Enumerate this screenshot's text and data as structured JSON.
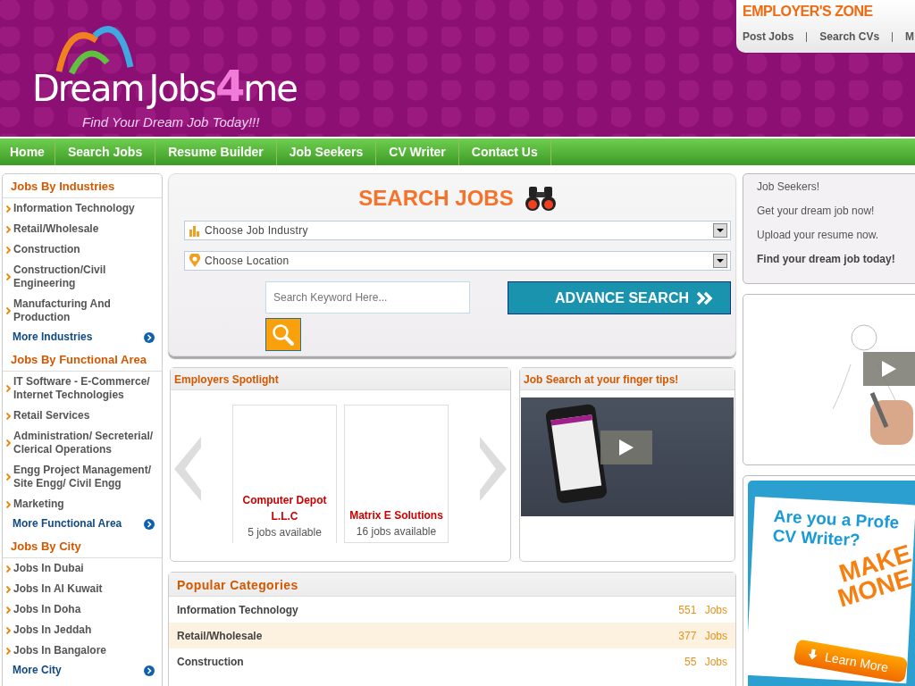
{
  "logo": {
    "words": [
      "Dream",
      "Jobs",
      "4",
      "me"
    ],
    "tagline": "Find Your Dream Job Today!!!"
  },
  "employer_zone": {
    "title": "EMPLOYER'S ZONE",
    "links": [
      "Post Jobs",
      "Search CVs",
      "M"
    ]
  },
  "nav": [
    "Home",
    "Search Jobs",
    "Resume Builder",
    "Job Seekers",
    "CV Writer",
    "Contact Us"
  ],
  "sidebar": [
    {
      "title": "Jobs By Industries",
      "items": [
        "Information Technology",
        "Retail/Wholesale",
        "Construction",
        "Construction/Civil Engineering",
        "Manufacturing And Production"
      ],
      "more": "More Industries"
    },
    {
      "title": "Jobs By Functional Area",
      "items": [
        "IT Software - E-Commerce/ Internet Technologies",
        "Retail Services",
        "Administration/ Secreterial/ Clerical Operations",
        "Engg Project Management/ Site Engg/ Civil Engg",
        "Marketing"
      ],
      "more": "More Functional Area"
    },
    {
      "title": "Jobs By City",
      "items": [
        "Jobs In Dubai",
        "Jobs In Al Kuwait",
        "Jobs In Doha",
        "Jobs In Jeddah",
        "Jobs In Bangalore"
      ],
      "more": "More City"
    }
  ],
  "search": {
    "title": "SEARCH JOBS",
    "industry": "Choose Job Industry",
    "location": "Choose Location",
    "keyword_placeholder": "Search Keyword Here...",
    "advance_button": "ADVANCE SEARCH"
  },
  "spotlight": {
    "title": "Employers Spotlight",
    "employers": [
      {
        "name": "Computer Depot L.L.C",
        "jobs": "5 jobs available"
      },
      {
        "name": "Matrix E Solutions",
        "jobs": "16 jobs available"
      }
    ]
  },
  "app_panel": {
    "title": "Job Search at your finger tips!"
  },
  "popular_categories": {
    "title": "Popular Categories",
    "rows": [
      {
        "name": "Information Technology",
        "count": "551",
        "unit": "Jobs"
      },
      {
        "name": "Retail/Wholesale",
        "count": "377",
        "unit": "Jobs"
      },
      {
        "name": "Construction",
        "count": "55",
        "unit": "Jobs"
      }
    ]
  },
  "seekers_box": [
    {
      "text": "Job Seekers!",
      "bold": false
    },
    {
      "text": "Get your dream job now!",
      "bold": false
    },
    {
      "text": "Upload your resume now.",
      "bold": false
    },
    {
      "text": "Find your dream job today!",
      "bold": true
    }
  ],
  "cv_ad": {
    "headline": [
      "Are you a Profe",
      "CV Writer?"
    ],
    "slogan": [
      "MAKE",
      "MONE"
    ],
    "button": "Learn More"
  }
}
